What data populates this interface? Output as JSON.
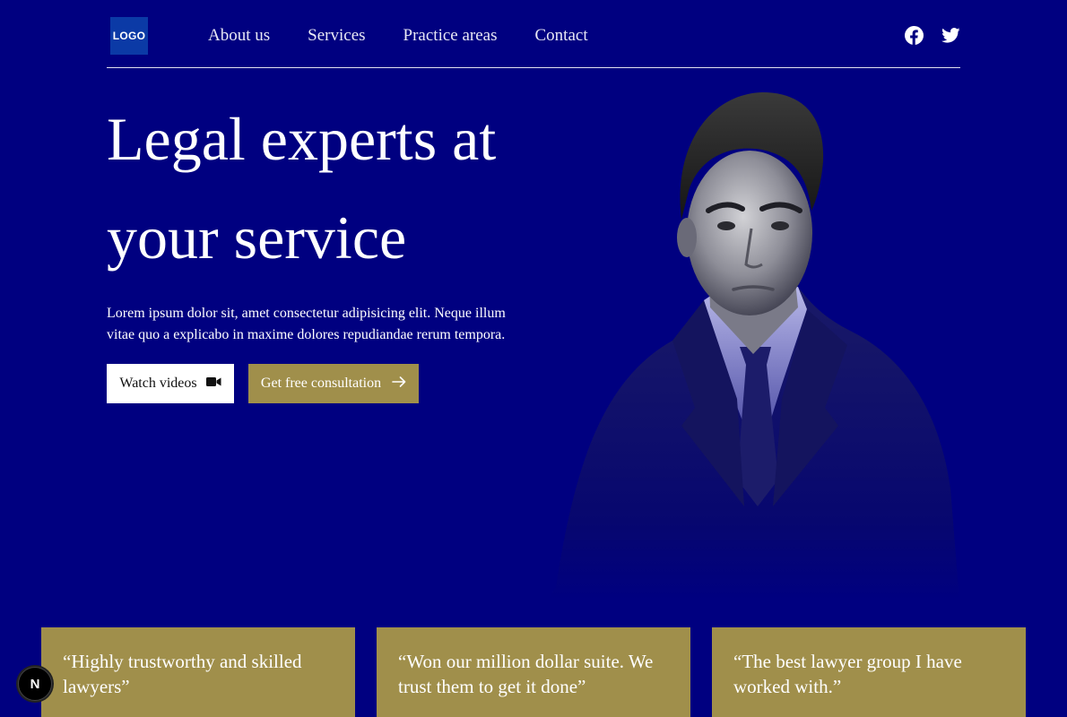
{
  "header": {
    "logo_text": "LOGO",
    "nav": [
      {
        "label": "About us"
      },
      {
        "label": "Services"
      },
      {
        "label": "Practice areas"
      },
      {
        "label": "Contact"
      }
    ],
    "social_icons": [
      "facebook-icon",
      "twitter-icon"
    ]
  },
  "hero": {
    "title": "Legal experts at your service",
    "description": "Lorem ipsum dolor sit, amet consectetur adipisicing elit. Neque illum vitae quo a explicabo in maxime dolores repudiandae rerum tempora.",
    "watch_label": "Watch videos",
    "consult_label": "Get free consultation"
  },
  "testimonials": [
    {
      "quote": "“Highly trustworthy and skilled lawyers”"
    },
    {
      "quote": "“Won our million dollar suite. We trust them to get it done”"
    },
    {
      "quote": "“The best lawyer group I have worked with.”"
    }
  ],
  "badge": {
    "letter": "N"
  },
  "colors": {
    "background": "#000080",
    "accent": "#a08f4b",
    "logo_bg": "#0b3aa6"
  }
}
